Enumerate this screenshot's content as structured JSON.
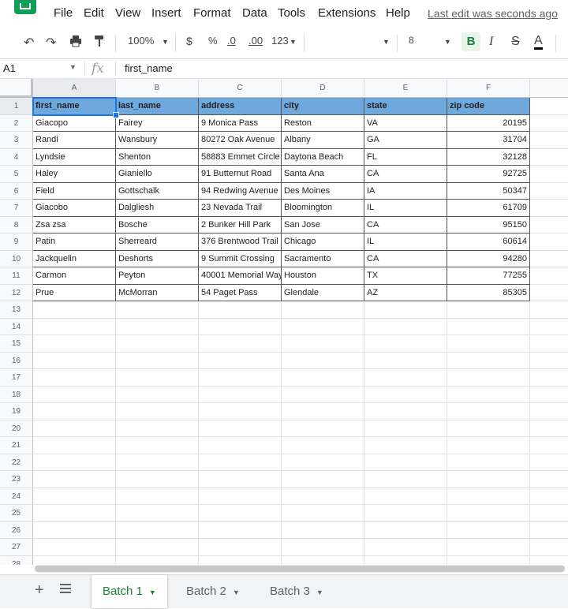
{
  "menubar": {
    "items": [
      "File",
      "Edit",
      "View",
      "Insert",
      "Format",
      "Data",
      "Tools",
      "Extensions",
      "Help"
    ],
    "last_edit": "Last edit was seconds ago"
  },
  "toolbar": {
    "zoom": "100%",
    "currency": "$",
    "percent": "%",
    "decrease_decimal": ".0",
    "increase_decimal": ".00",
    "number_format": "123",
    "font_size": "8",
    "bold": "B",
    "italic": "I",
    "strikethrough": "S",
    "text_color": "A"
  },
  "formula_bar": {
    "name_box": "A1",
    "fx": "fx",
    "value": "first_name"
  },
  "grid": {
    "columns": [
      "A",
      "B",
      "C",
      "D",
      "E",
      "F"
    ],
    "row_numbers": [
      "1",
      "2",
      "3",
      "4",
      "5",
      "6",
      "7",
      "8",
      "9",
      "10",
      "11",
      "12",
      "13",
      "14",
      "15",
      "16",
      "17",
      "18",
      "19",
      "20",
      "21",
      "22",
      "23",
      "24",
      "25",
      "26",
      "27",
      "28"
    ],
    "header": [
      "first_name",
      "last_name",
      "address",
      "city",
      "state",
      "zip code"
    ],
    "rows": [
      [
        "Giacopo",
        "Fairey",
        "9 Monica Pass",
        "Reston",
        "VA",
        "20195"
      ],
      [
        "Randi",
        "Wansbury",
        "80272 Oak Avenue",
        "Albany",
        "GA",
        "31704"
      ],
      [
        "Lyndsie",
        "Shenton",
        "58883 Emmet Circle",
        "Daytona Beach",
        "FL",
        "32128"
      ],
      [
        "Haley",
        "Gianiello",
        "91 Butternut Road",
        "Santa Ana",
        "CA",
        "92725"
      ],
      [
        "Field",
        "Gottschalk",
        "94 Redwing Avenue",
        "Des Moines",
        "IA",
        "50347"
      ],
      [
        "Giacobo",
        "Dalgliesh",
        "23 Nevada Trail",
        "Bloomington",
        "IL",
        "61709"
      ],
      [
        "Zsa zsa",
        "Bosche",
        "2 Bunker Hill Park",
        "San Jose",
        "CA",
        "95150"
      ],
      [
        "Patin",
        "Sherreard",
        "376 Brentwood Trail",
        "Chicago",
        "IL",
        "60614"
      ],
      [
        "Jackquelin",
        "Deshorts",
        "9 Summit Crossing",
        "Sacramento",
        "CA",
        "94280"
      ],
      [
        "Carmon",
        "Peyton",
        "40001 Memorial Way",
        "Houston",
        "TX",
        "77255"
      ],
      [
        "Prue",
        "McMorran",
        "54 Paget Pass",
        "Glendale",
        "AZ",
        "85305"
      ]
    ],
    "header_color": "#6fa8dc",
    "selected_cell": "A1"
  },
  "sheet_tabs": {
    "add": "+",
    "tabs": [
      "Batch 1",
      "Batch 2",
      "Batch 3"
    ],
    "active": "Batch 1"
  },
  "colors": {
    "accent": "#188038",
    "selection": "#1a73e8"
  }
}
